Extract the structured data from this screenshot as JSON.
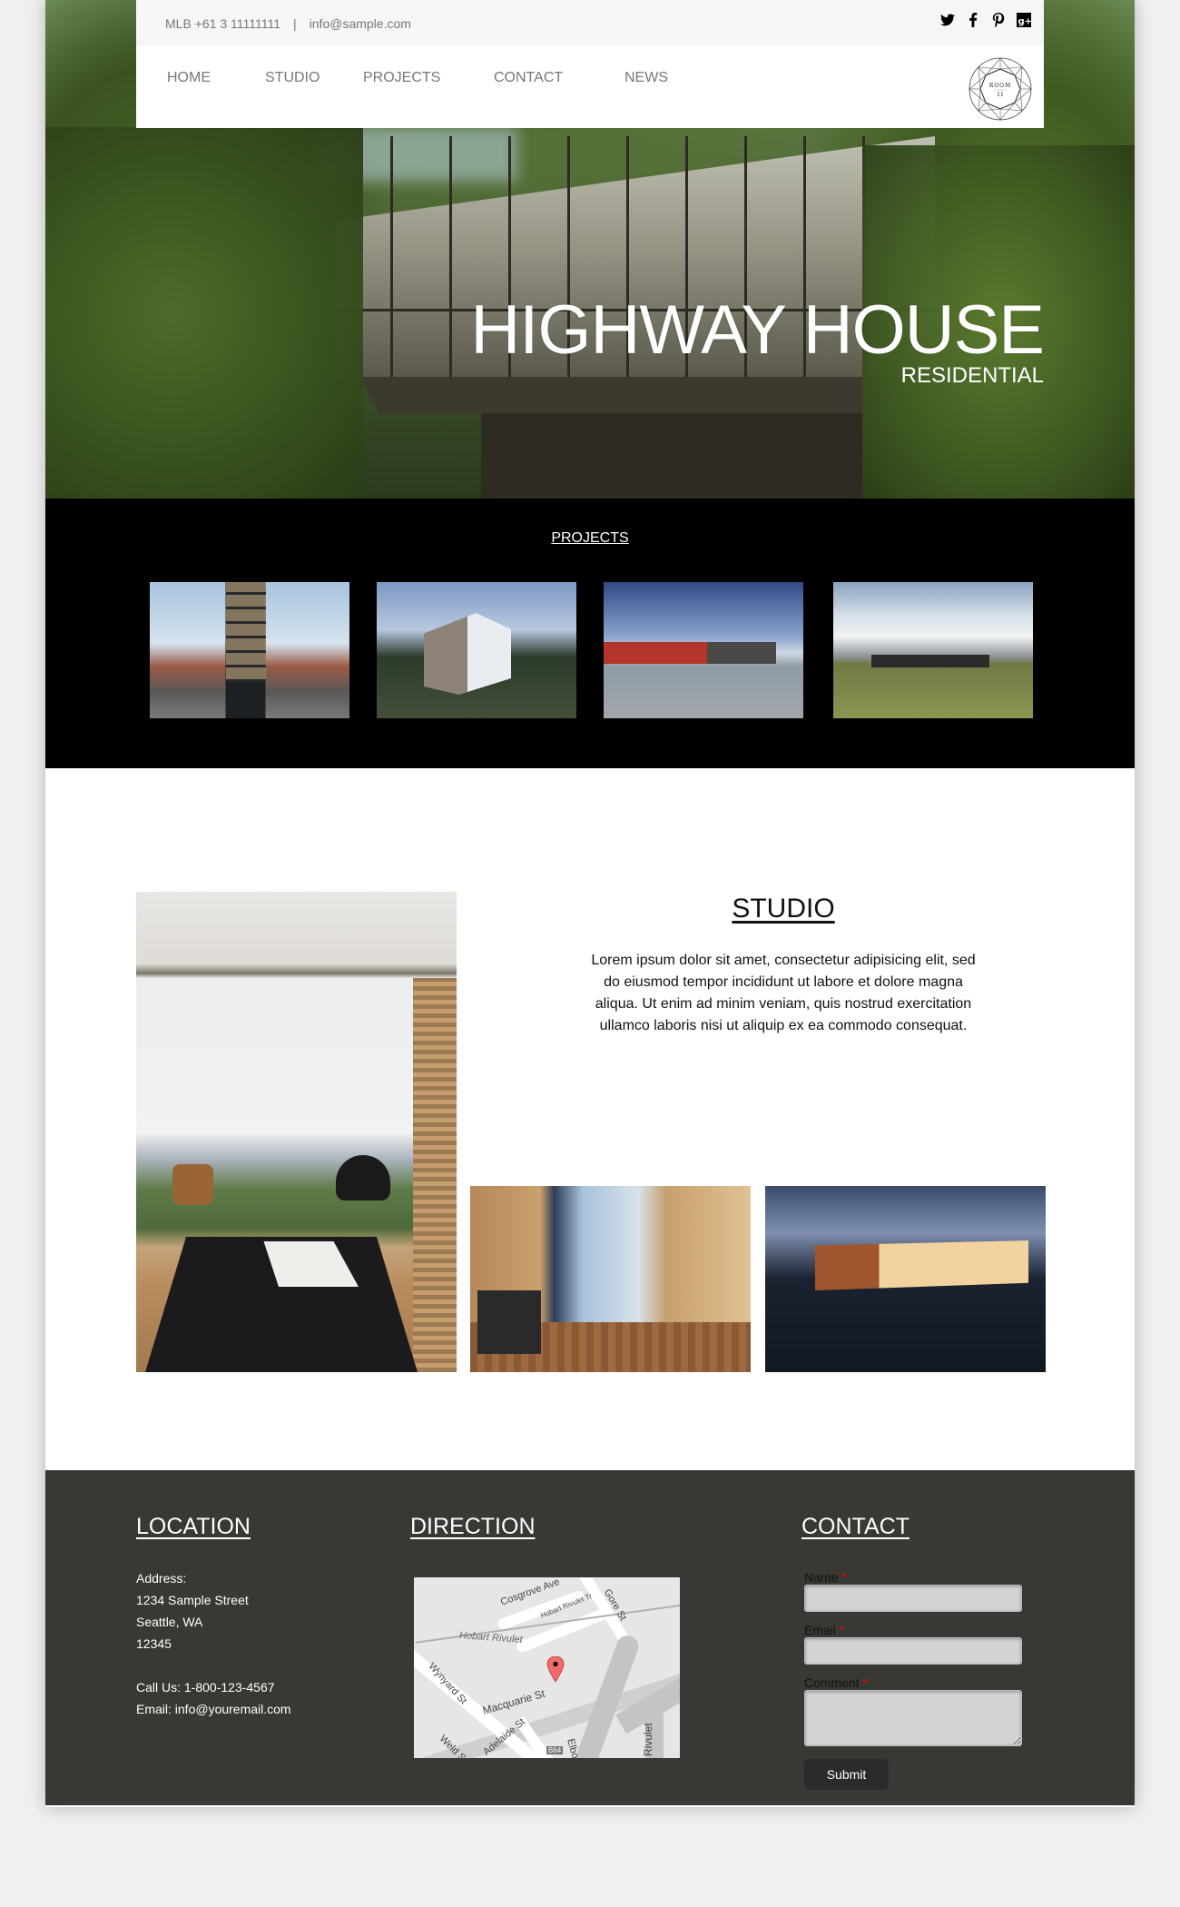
{
  "topbar": {
    "phone": "MLB +61 3 11111111",
    "separator": "|",
    "email": "info@sample.com",
    "social": [
      {
        "name": "twitter-icon",
        "glyph": "🐦"
      },
      {
        "name": "facebook-icon",
        "glyph": "f"
      },
      {
        "name": "pinterest-icon",
        "glyph": "P"
      },
      {
        "name": "google-plus-icon",
        "glyph": "g+"
      }
    ]
  },
  "nav": {
    "items": [
      "HOME",
      "STUDIO",
      "PROJECTS",
      "CONTACT",
      "NEWS"
    ],
    "logo": {
      "line1": "ROOM",
      "line2": "11"
    }
  },
  "hero": {
    "title": "HIGHWAY HOUSE",
    "subtitle": "RESIDENTIAL"
  },
  "projects": {
    "heading": "PROJECTS",
    "thumbnails": [
      "project-thumb-urban-tower",
      "project-thumb-timber-house",
      "project-thumb-red-pavilion",
      "project-thumb-lawn-pavilion"
    ]
  },
  "studio": {
    "heading": "STUDIO",
    "body": "Lorem ipsum dolor sit amet, consectetur adipisicing elit, sed do eiusmod tempor incididunt ut labore et dolore magna aliqua. Ut enim ad minim veniam, quis nostrud exercitation ullamco laboris nisi ut aliquip ex ea commodo consequat."
  },
  "footer": {
    "location": {
      "heading": "LOCATION",
      "address_label": "Address:",
      "street": "1234 Sample Street",
      "city": "Seattle, WA",
      "zip": "12345",
      "phone": "Call Us: 1-800-123-4567",
      "email": "Email: info@youremail.com"
    },
    "direction": {
      "heading": "DIRECTION",
      "map_labels": [
        "Cosgrove Ave",
        "Hobart Rivulet Tr",
        "Gore St",
        "Hobart Rivulet",
        "Wynyard St",
        "Macquarie St",
        "Weld St",
        "Adelaide St",
        "B64",
        "Elboden St",
        "Rivulet"
      ]
    },
    "contact": {
      "heading": "CONTACT",
      "name_label": "Name",
      "email_label": "Email",
      "comment_label": "Comment",
      "required_mark": "*",
      "name_value": "",
      "email_value": "",
      "comment_value": "",
      "submit_label": "Submit"
    }
  },
  "colors": {
    "page_bg": "#f0f0f0",
    "footer_bg": "#3a3834",
    "projects_bg": "#000000",
    "required": "#ee0000",
    "submit_bg": "#2b2b2b"
  }
}
